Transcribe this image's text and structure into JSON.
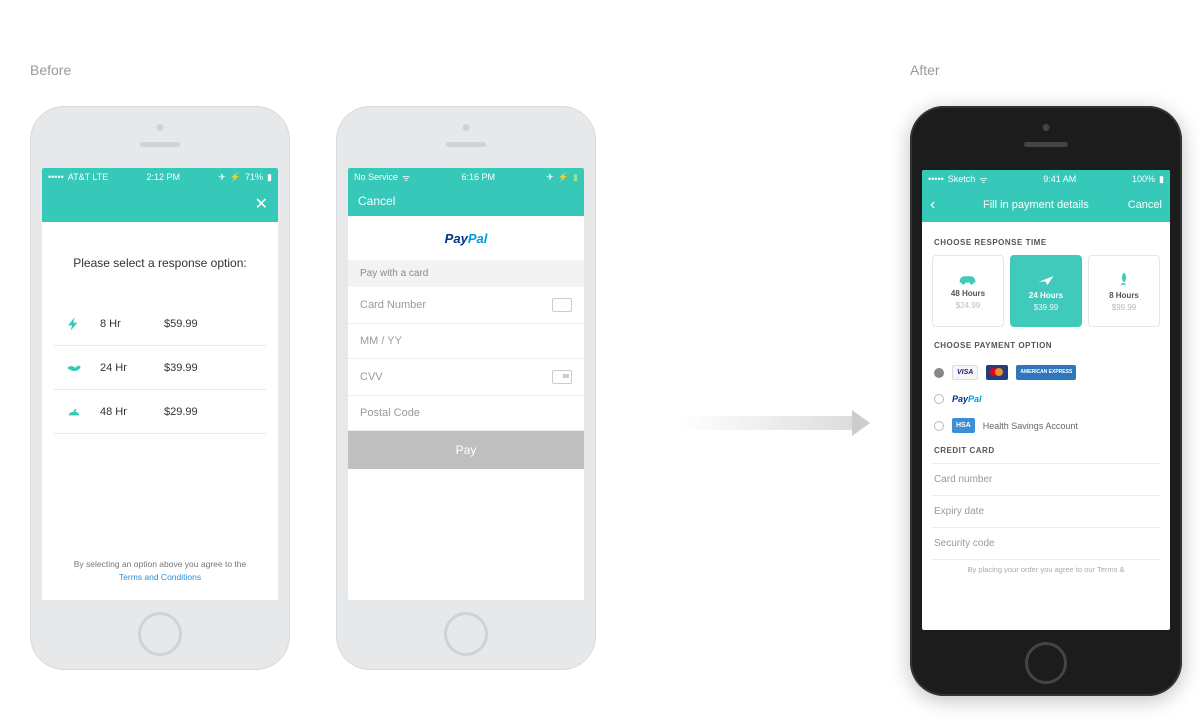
{
  "labels": {
    "before": "Before",
    "after": "After"
  },
  "phone1": {
    "status": {
      "carrier": "AT&T  LTE",
      "time": "2:12 PM",
      "battery": "71%"
    },
    "close": "✕",
    "heading": "Please select a response option:",
    "options": [
      {
        "time": "8 Hr",
        "price": "$59.99"
      },
      {
        "time": "24 Hr",
        "price": "$39.99"
      },
      {
        "time": "48 Hr",
        "price": "$29.99"
      }
    ],
    "footer": {
      "line": "By selecting an option above you agree to the",
      "link": "Terms and Conditions"
    }
  },
  "phone2": {
    "status": {
      "carrier": "No Service",
      "time": "6:16 PM"
    },
    "cancel": "Cancel",
    "brand_a": "Pay",
    "brand_b": "Pal",
    "subhead": "Pay with a card",
    "fields": {
      "card": "Card Number",
      "exp": "MM / YY",
      "cvv": "CVV",
      "postal": "Postal Code"
    },
    "pay": "Pay"
  },
  "phone3": {
    "status": {
      "carrier": "Sketch",
      "time": "9:41 AM",
      "battery": "100%"
    },
    "nav": {
      "title": "Fill in payment details",
      "cancel": "Cancel"
    },
    "section_time": "CHOOSE RESPONSE TIME",
    "tiles": [
      {
        "label": "48 Hours",
        "price": "$24.99"
      },
      {
        "label": "24 Hours",
        "price": "$39.99"
      },
      {
        "label": "8 Hours",
        "price": "$99.99"
      }
    ],
    "section_pay": "CHOOSE PAYMENT OPTION",
    "visa": "VISA",
    "amex": "AMERICAN EXPRESS",
    "brand_a": "Pay",
    "brand_b": "Pal",
    "hsa": "HSA",
    "hsa_label": "Health Savings Account",
    "section_cc": "CREDIT CARD",
    "fields": {
      "card": "Card number",
      "exp": "Expiry date",
      "cvv": "Security code"
    },
    "footer": "By placing your order you agree to our Terms &"
  }
}
